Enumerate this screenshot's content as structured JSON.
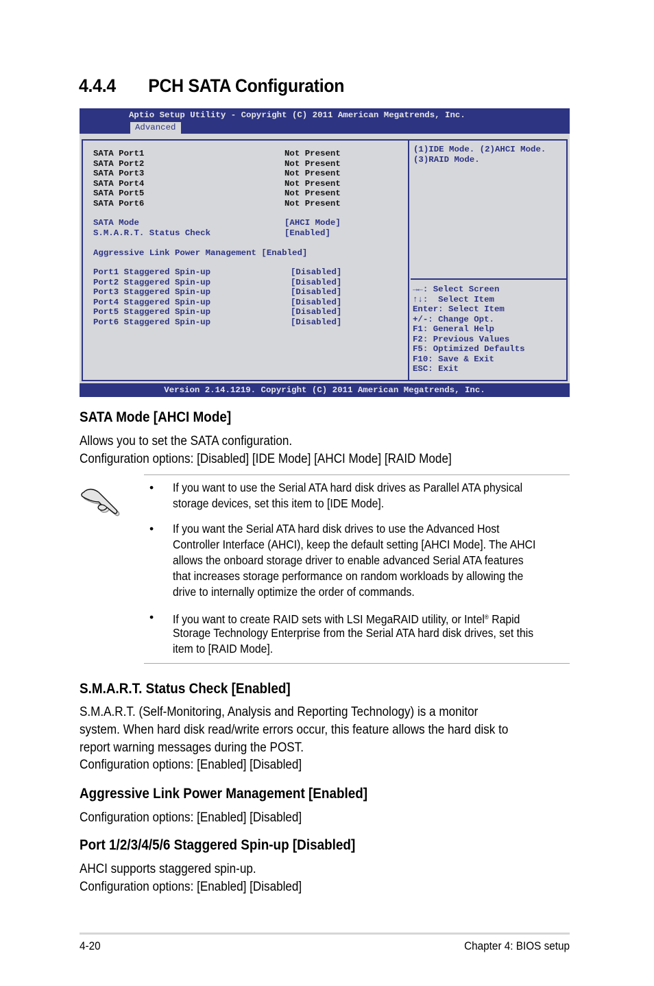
{
  "section": {
    "number": "4.4.4",
    "title": "PCH SATA Configuration"
  },
  "bios": {
    "header_title": "Aptio Setup Utility - Copyright (C) 2011 American Megatrends, Inc.",
    "active_tab": "Advanced",
    "ports": [
      {
        "label": "SATA Port1",
        "value": "Not Present"
      },
      {
        "label": "SATA Port2",
        "value": "Not Present"
      },
      {
        "label": "SATA Port3",
        "value": "Not Present"
      },
      {
        "label": "SATA Port4",
        "value": "Not Present"
      },
      {
        "label": "SATA Port5",
        "value": "Not Present"
      },
      {
        "label": "SATA Port6",
        "value": "Not Present"
      }
    ],
    "settings": [
      {
        "label": "SATA Mode",
        "value": "[AHCI Mode]"
      },
      {
        "label": "S.M.A.R.T. Status Check",
        "value": "[Enabled]"
      }
    ],
    "alpm": {
      "label": "Aggressive Link Power Management",
      "value": "[Enabled]"
    },
    "spinup": [
      {
        "label": "Port1 Staggered Spin-up",
        "value": "[Disabled]"
      },
      {
        "label": "Port2 Staggered Spin-up",
        "value": "[Disabled]"
      },
      {
        "label": "Port3 Staggered Spin-up",
        "value": "[Disabled]"
      },
      {
        "label": "Port4 Staggered Spin-up",
        "value": "[Disabled]"
      },
      {
        "label": "Port5 Staggered Spin-up",
        "value": "[Disabled]"
      },
      {
        "label": "Port6 Staggered Spin-up",
        "value": "[Disabled]"
      }
    ],
    "help_lines": [
      "(1)IDE Mode. (2)AHCI Mode.",
      "(3)RAID Mode."
    ],
    "key_help": [
      "→←: Select Screen",
      "↑↓:  Select Item",
      "Enter: Select Item",
      "+/-: Change Opt.",
      "F1: General Help",
      "F2: Previous Values",
      "F5: Optimized Defaults",
      "F10: Save & Exit",
      "ESC: Exit"
    ],
    "footer": "Version 2.14.1219. Copyright (C) 2011 American Megatrends, Inc."
  },
  "sata_mode": {
    "heading": "SATA Mode [AHCI Mode]",
    "lines": [
      "Allows you to set the SATA configuration.",
      "Configuration options: [Disabled] [IDE Mode] [AHCI Mode] [RAID Mode]"
    ],
    "note_icon": "pointing-hand-icon",
    "notes": [
      {
        "lines": [
          "If you want to use the Serial ATA hard disk drives as Parallel ATA physical",
          "storage devices, set this item to [IDE Mode]."
        ]
      },
      {
        "lines": [
          "If you want the Serial ATA hard disk drives to use the Advanced Host",
          "Controller Interface (AHCI), keep the default setting [AHCI Mode]. The AHCI",
          "allows the onboard storage driver to enable advanced Serial ATA features",
          "that increases storage performance on random workloads by allowing the",
          "drive to internally optimize the order of commands."
        ]
      },
      {
        "line1_pre": "If you want to create RAID sets with LSI MegaRAID utility, or Intel",
        "line1_sup": "®",
        "line1_post": " Rapid",
        "lines": [
          "Storage Technology Enterprise from the Serial ATA hard disk drives, set this",
          "item to [RAID Mode]."
        ]
      }
    ],
    "bullet": "•"
  },
  "smart": {
    "heading": "S.M.A.R.T. Status Check [Enabled]",
    "lines": [
      "S.M.A.R.T. (Self-Monitoring, Analysis and Reporting Technology) is a monitor",
      "system. When hard disk read/write errors occur, this feature allows the hard disk to",
      "report warning messages during the POST.",
      "Configuration options: [Enabled] [Disabled]"
    ]
  },
  "alpm_section": {
    "heading": "Aggressive Link Power Management [Enabled]",
    "lines": [
      "Configuration options: [Enabled] [Disabled]"
    ]
  },
  "spinup_section": {
    "heading": "Port 1/2/3/4/5/6 Staggered Spin-up [Disabled]",
    "lines": [
      "AHCI supports staggered spin-up.",
      "Configuration options: [Enabled] [Disabled]"
    ]
  },
  "footer": {
    "page_number": "4-20",
    "chapter": "Chapter 4: BIOS setup"
  }
}
